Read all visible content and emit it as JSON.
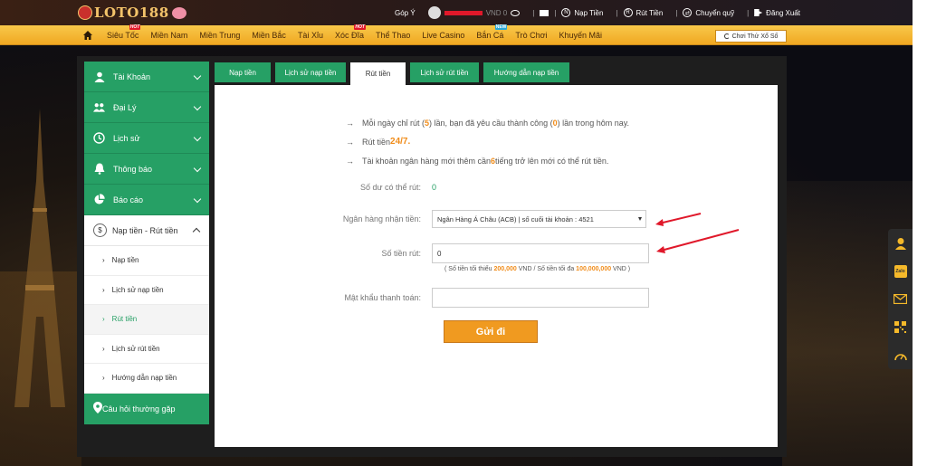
{
  "header": {
    "logo_text": "LOTO188",
    "feedback": "Góp Ý",
    "balance": "VND 0",
    "deposit": "Nạp Tiền",
    "withdraw": "Rút Tiền",
    "transfer": "Chuyển quỹ",
    "logout": "Đăng Xuất",
    "deposit_icon": "N",
    "withdraw_icon": "R"
  },
  "menu": {
    "items": [
      {
        "label": "Siêu Tốc",
        "badge": "HOT"
      },
      {
        "label": "Miền Nam",
        "badge": ""
      },
      {
        "label": "Miền Trung",
        "badge": ""
      },
      {
        "label": "Miền Bắc",
        "badge": ""
      },
      {
        "label": "Tài Xỉu",
        "badge": ""
      },
      {
        "label": "Xóc Đĩa",
        "badge": "HOT"
      },
      {
        "label": "Thể Thao",
        "badge": ""
      },
      {
        "label": "Live Casino",
        "badge": ""
      },
      {
        "label": "Bắn Cá",
        "badge": "NEW"
      },
      {
        "label": "Trò Chơi",
        "badge": ""
      },
      {
        "label": "Khuyến Mãi",
        "badge": ""
      }
    ],
    "play_button": "Chơi Thử Xổ Số"
  },
  "sidebar": {
    "items": [
      {
        "label": "Tài Khoản",
        "icon": "user-icon"
      },
      {
        "label": "Đại Lý",
        "icon": "group-icon"
      },
      {
        "label": "Lịch sử",
        "icon": "history-icon"
      },
      {
        "label": "Thông báo",
        "icon": "bell-icon"
      },
      {
        "label": "Báo cáo",
        "icon": "pie-chart-icon"
      }
    ],
    "open_section": "Nạp tiền - Rút tiền",
    "open_icon": "$",
    "sub_items": [
      {
        "label": "Nạp tiền"
      },
      {
        "label": "Lịch sử nạp tiền"
      },
      {
        "label": "Rút tiền"
      },
      {
        "label": "Lịch sử rút tiền"
      },
      {
        "label": "Hướng dẫn nạp tiền"
      }
    ],
    "faq": "Câu hỏi thường gặp"
  },
  "tabs": [
    {
      "label": "Nạp tiền",
      "active": false
    },
    {
      "label": "Lịch sử nạp tiền",
      "active": false
    },
    {
      "label": "Rút tiền",
      "active": true
    },
    {
      "label": "Lịch sử rút tiền",
      "active": false
    },
    {
      "label": "Hướng dẫn nạp tiền",
      "active": false
    }
  ],
  "info": {
    "bullet": "→",
    "line1_a": "Mỗi ngày chỉ rút (",
    "line1_limit": "5",
    "line1_b": ") lần, bạn đã yêu cầu thành công (",
    "line1_done": "0",
    "line1_c": ") lần trong hôm nay.",
    "line2_a": "Rút tiền ",
    "line2_b": "24/7.",
    "line3_a": "Tài khoản ngân hàng mới thêm cần ",
    "line3_hours": "6",
    "line3_b": " tiếng trở lên mới có thể rút tiền."
  },
  "form": {
    "balance_label": "Số dư có thể rút:",
    "balance_value": "0",
    "bank_label": "Ngân hàng nhận tiền:",
    "bank_value": "Ngân Hàng Á Châu (ACB) | số cuối tài khoản : 4521",
    "amount_label": "Số tiền rút:",
    "amount_value": "0",
    "hint_a": "( Số tiền tối thiểu ",
    "hint_min": "200,000",
    "hint_b": " VND / Số tiền tối đa ",
    "hint_max": "100,000,000",
    "hint_c": " VND )",
    "password_label": "Mật khẩu thanh toán:",
    "password_value": "",
    "submit": "Gửi đi"
  },
  "floatbar": {
    "items": [
      {
        "icon": "user-support-icon",
        "label": ""
      },
      {
        "icon": "zalo-icon",
        "label": "Zalo"
      },
      {
        "icon": "mail-icon",
        "label": ""
      },
      {
        "icon": "qr-code-icon",
        "label": ""
      },
      {
        "icon": "speed-icon",
        "label": ""
      }
    ]
  },
  "colors": {
    "green": "#26a065",
    "gold": "#f0a822",
    "orange": "#f09a20",
    "annotation_red": "#e0182a"
  }
}
